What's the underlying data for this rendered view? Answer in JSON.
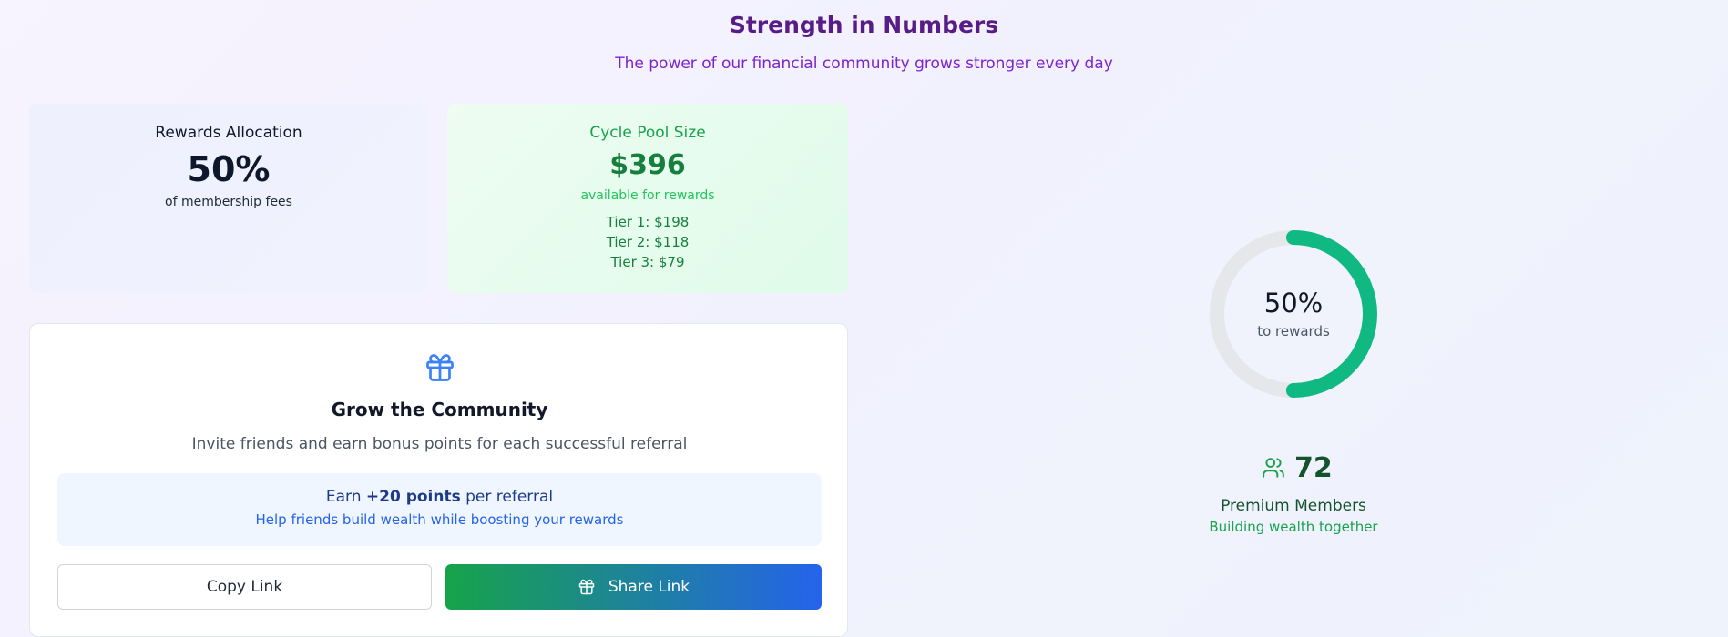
{
  "header": {
    "title": "Strength in Numbers",
    "subtitle": "The power of our financial community grows stronger every day"
  },
  "rewards_card": {
    "label": "Rewards Allocation",
    "value": "50%",
    "sub": "of membership fees"
  },
  "pool_card": {
    "label": "Cycle Pool Size",
    "value": "$396",
    "sub": "available for rewards",
    "tiers": [
      "Tier 1: $198",
      "Tier 2: $118",
      "Tier 3: $79"
    ]
  },
  "grow_card": {
    "icon": "gift-icon",
    "title": "Grow the Community",
    "description": "Invite friends and earn bonus points for each successful referral",
    "earn_prefix": "Earn ",
    "earn_points": "+20 points",
    "earn_suffix": " per referral",
    "earn_sub": "Help friends build wealth while boosting your rewards",
    "copy_label": "Copy Link",
    "share_label": "Share Link"
  },
  "donut": {
    "fraction": 0.5,
    "percent_label": "50%",
    "label": "to rewards",
    "color": "#10b981",
    "track_color": "#e5e7eb"
  },
  "members": {
    "icon": "users-icon",
    "count": "72",
    "label": "Premium Members",
    "sub": "Building wealth together"
  }
}
